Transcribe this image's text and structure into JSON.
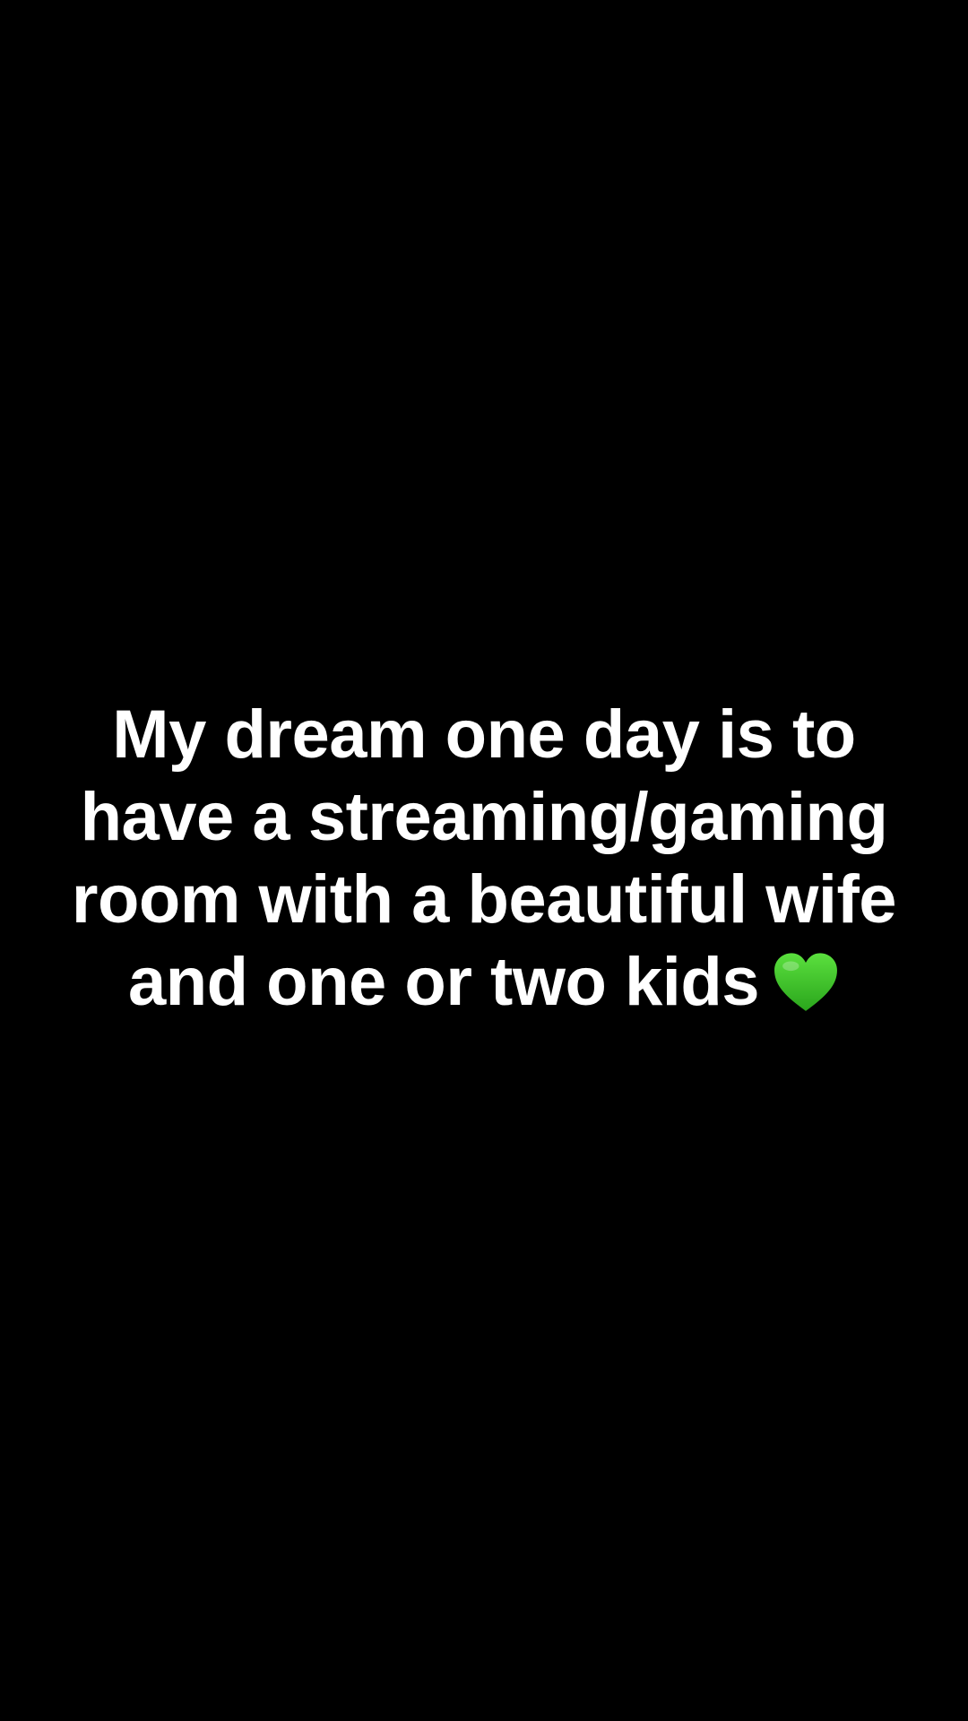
{
  "caption": {
    "lines": [
      "My dream one day is to",
      "have a streaming/gaming",
      "room with a beautiful wife",
      "and one or two kids"
    ],
    "emoji": "green-heart-icon",
    "text_color": "#ffffff",
    "emoji_color": "#3fc72b"
  },
  "background_color": "#000000"
}
